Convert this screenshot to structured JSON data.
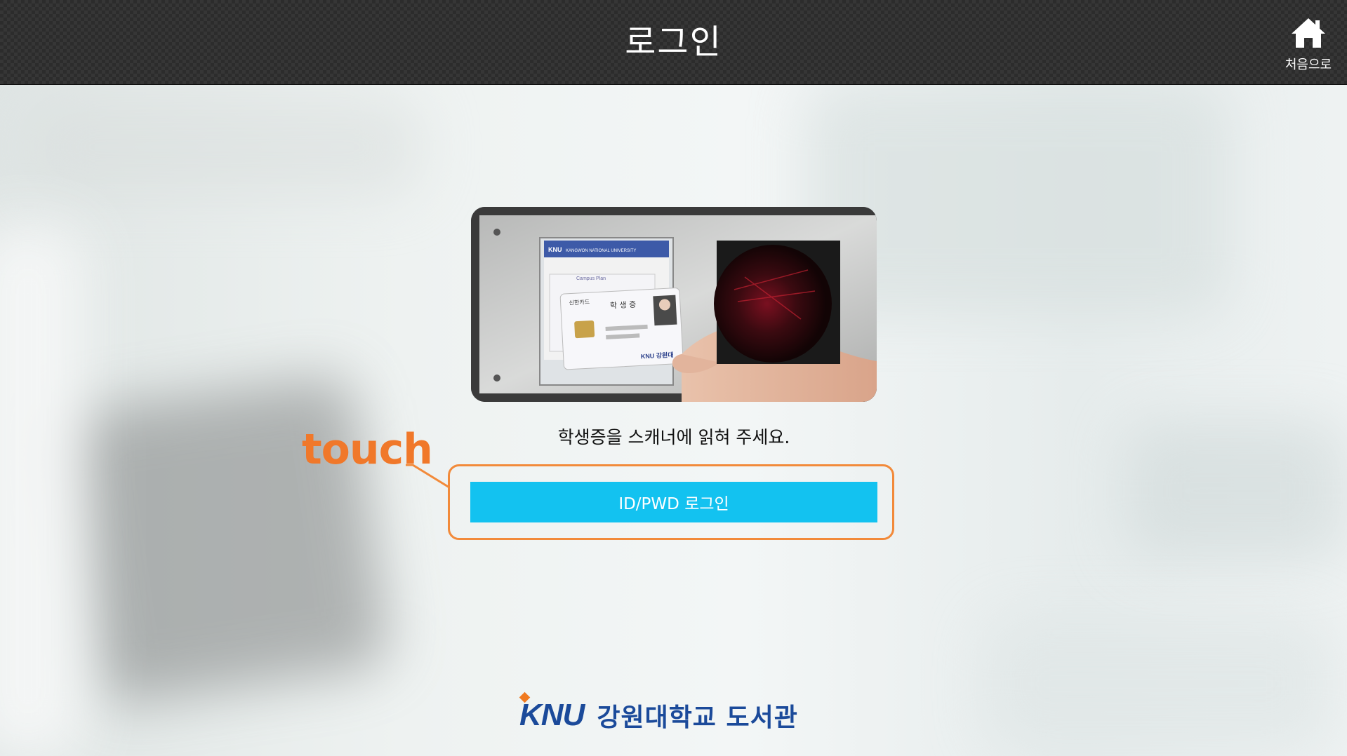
{
  "header": {
    "title": "로그인",
    "home_label": "처음으로"
  },
  "main": {
    "instruction": "학생증을 스캐너에 읽혀 주세요.",
    "login_button": "ID/PWD 로그인",
    "annotation": "touch"
  },
  "scanner_photo": {
    "card_header": "KNU KANGWON NATIONAL UNIVERSITY",
    "card_line": "Campus Plan",
    "card_bank": "신한카드",
    "card_title": "학 생 증",
    "card_brand": "KNU 강원대"
  },
  "footer": {
    "logo_mark": "KNU",
    "logo_text": "강원대학교 도서관"
  },
  "colors": {
    "header_bg": "#2c2c2c",
    "button_bg": "#13c2f0",
    "annotation": "#f0782a",
    "brand_blue": "#1b4a9a",
    "brand_orange": "#f07a20"
  }
}
